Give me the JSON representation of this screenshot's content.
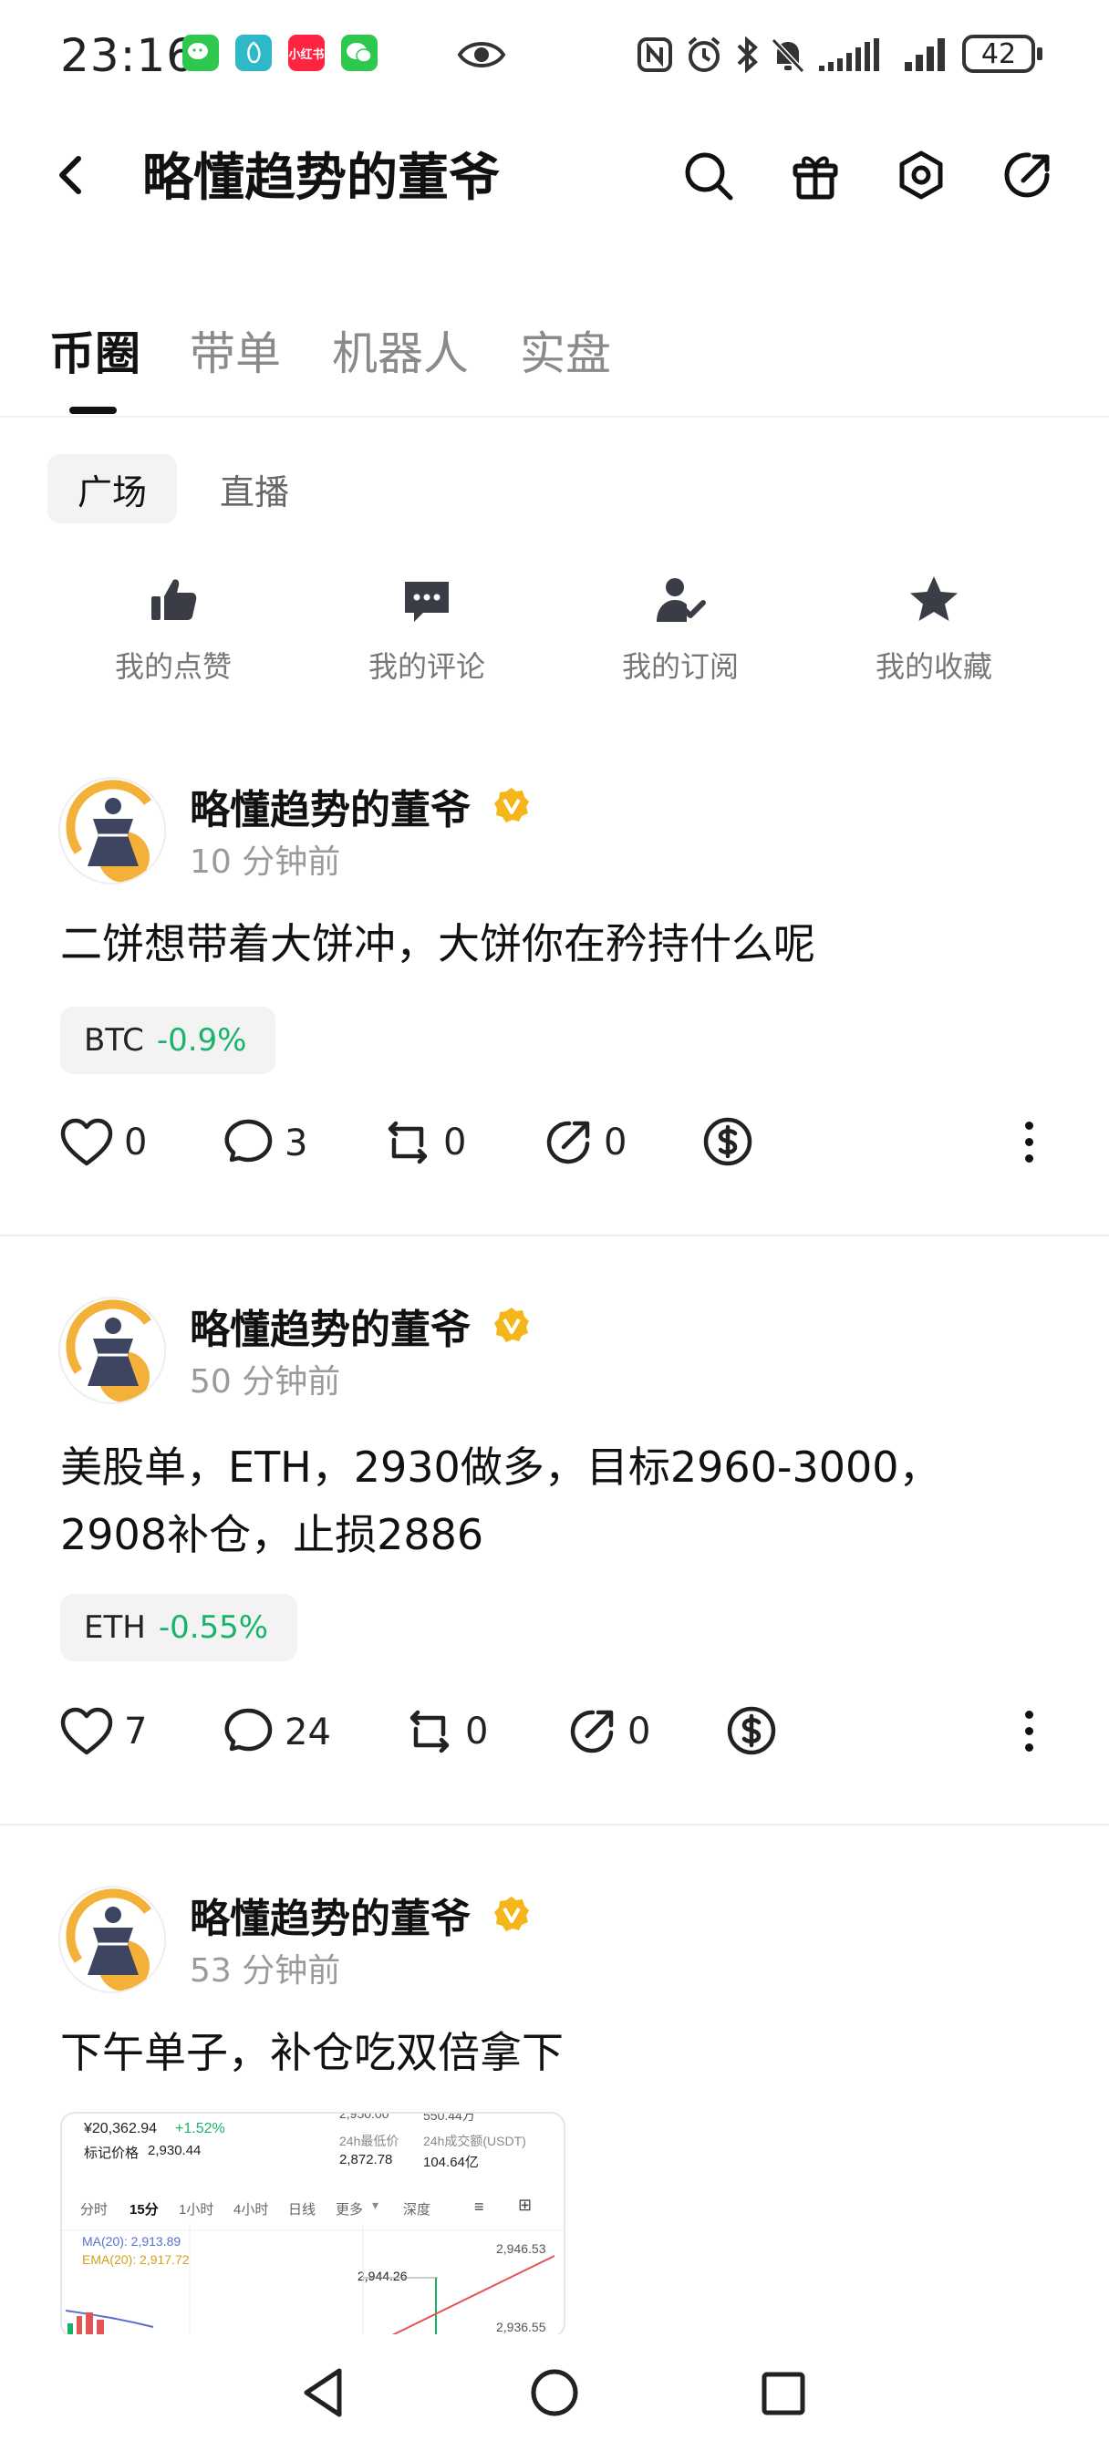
{
  "status_bar": {
    "time": "23:16",
    "apps": [
      "微信",
      "通知",
      "小红书",
      "微信"
    ],
    "battery": "42",
    "icons": [
      "eye-icon",
      "nfc-icon",
      "alarm-icon",
      "bluetooth-icon",
      "mute-icon",
      "signal-icon",
      "signal-icon",
      "battery-icon"
    ]
  },
  "header": {
    "title": "略懂趋势的董爷",
    "icons": [
      "back-icon",
      "search-icon",
      "gift-icon",
      "settings-icon",
      "share-icon"
    ]
  },
  "tabs": [
    "币圈",
    "带单",
    "机器人",
    "实盘"
  ],
  "subtabs": [
    "广场",
    "直播"
  ],
  "quick_actions": [
    {
      "label": "我的点赞",
      "icon": "thumbs-up-icon"
    },
    {
      "label": "我的评论",
      "icon": "comment-icon"
    },
    {
      "label": "我的订阅",
      "icon": "subscribe-icon"
    },
    {
      "label": "我的收藏",
      "icon": "star-icon"
    }
  ],
  "posts": [
    {
      "author": "略懂趋势的董爷",
      "time": "10 分钟前",
      "text": "二饼想带着大饼冲，大饼你在矜持什么呢",
      "ticker": {
        "symbol": "BTC",
        "change": "-0.9%"
      },
      "likes": "0",
      "comments": "3",
      "reposts": "0",
      "shares": "0"
    },
    {
      "author": "略懂趋势的董爷",
      "time": "50 分钟前",
      "text_line1": "美股单，ETH，2930做多，目标2960-3000，",
      "text_line2": "2908补仓，止损2886",
      "ticker": {
        "symbol": "ETH",
        "change": "-0.55%"
      },
      "likes": "7",
      "comments": "24",
      "reposts": "0",
      "shares": "0"
    },
    {
      "author": "略懂趋势的董爷",
      "time": "53 分钟前",
      "text": "下午单子，补仓吃双倍拿下"
    }
  ],
  "embedded_chart": {
    "price": "¥20,362.94",
    "change": "+1.52%",
    "mark_label": "标记价格",
    "mark_value": "2,930.44",
    "top_cut1": "2,950.00",
    "top_cut2": "550.44万",
    "low_label": "24h最低价",
    "low_value": "2,872.78",
    "vol_label": "24h成交额(USDT)",
    "vol_value": "104.64亿",
    "intervals": [
      "分时",
      "15分",
      "1小时",
      "4小时",
      "日线",
      "更多",
      "深度"
    ],
    "ma": "MA(20): 2,913.89",
    "ema": "EMA(20): 2,917.72",
    "p1": "2,946.53",
    "p2": "2,944.26",
    "p3": "2,936.55"
  },
  "nav_icons": [
    "nav-back-icon",
    "nav-home-icon",
    "nav-recents-icon"
  ]
}
